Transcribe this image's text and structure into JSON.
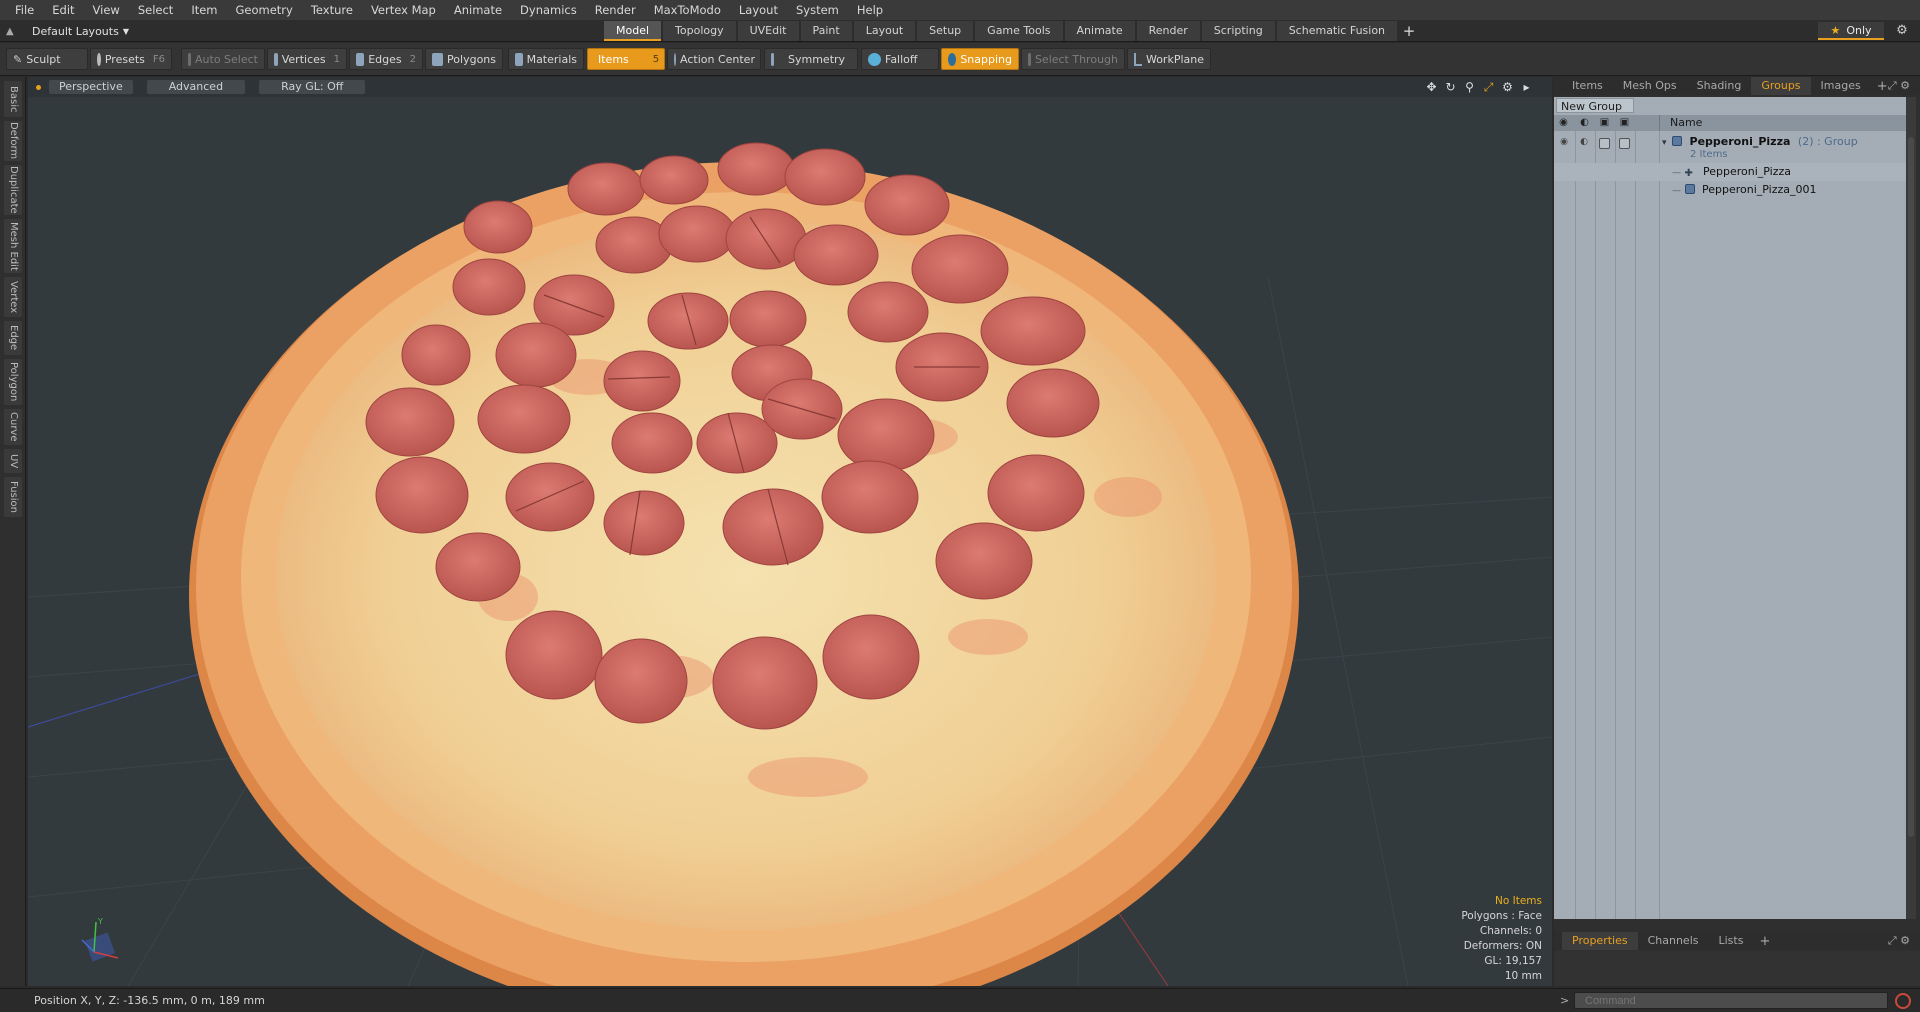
{
  "menu": [
    "File",
    "Edit",
    "View",
    "Select",
    "Item",
    "Geometry",
    "Texture",
    "Vertex Map",
    "Animate",
    "Dynamics",
    "Render",
    "MaxToModo",
    "Layout",
    "System",
    "Help"
  ],
  "layout_selector": "Default Layouts",
  "tabs": [
    "Model",
    "Topology",
    "UVEdit",
    "Paint",
    "Layout",
    "Setup",
    "Game Tools",
    "Animate",
    "Render",
    "Scripting",
    "Schematic Fusion"
  ],
  "active_tab": "Model",
  "only_label": "Only",
  "toolbar": {
    "sculpt": "Sculpt",
    "presets": "Presets",
    "presets_key": "F6",
    "auto_select": "Auto Select",
    "vertices": "Vertices",
    "vertices_count": "1",
    "edges": "Edges",
    "edges_count": "2",
    "polygons": "Polygons",
    "materials": "Materials",
    "items": "Items",
    "items_count": "5",
    "action_center": "Action Center",
    "symmetry": "Symmetry",
    "falloff": "Falloff",
    "snapping": "Snapping",
    "select_through": "Select Through",
    "workplane": "WorkPlane"
  },
  "left_tabs": [
    "Basic",
    "Deform",
    "Duplicate",
    "Mesh Edit",
    "Vertex",
    "Edge",
    "Polygon",
    "Curve",
    "UV",
    "Fusion"
  ],
  "viewport": {
    "view": "Perspective",
    "shading": "Advanced",
    "raygl": "Ray GL: Off",
    "info": {
      "selection": "No Items",
      "polygons": "Polygons : Face",
      "channels": "Channels: 0",
      "deformers": "Deformers: ON",
      "gl": "GL: 19,157",
      "scale": "10 mm"
    }
  },
  "right_panel": {
    "tabs": [
      "Items",
      "Mesh Ops",
      "Shading",
      "Groups",
      "Images"
    ],
    "active_tab": "Groups",
    "new_group": "New Group",
    "col_name": "Name",
    "group_name": "Pepperoni_Pizza",
    "group_suffix": "(2) : Group",
    "group_count": "2 Items",
    "children": [
      "Pepperoni_Pizza",
      "Pepperoni_Pizza_001"
    ],
    "bottom_tabs": [
      "Properties",
      "Channels",
      "Lists"
    ],
    "bottom_active": "Properties"
  },
  "status": {
    "position": "Position X, Y, Z:   -136.5 mm, 0 m, 189 mm",
    "command_placeholder": "Command"
  },
  "colors": {
    "accent": "#e89a1c",
    "viewport_bg": "#333a3e",
    "crust": "#e8a060",
    "cheese": "#f2dca0",
    "pepperoni": "#cf6a62"
  }
}
